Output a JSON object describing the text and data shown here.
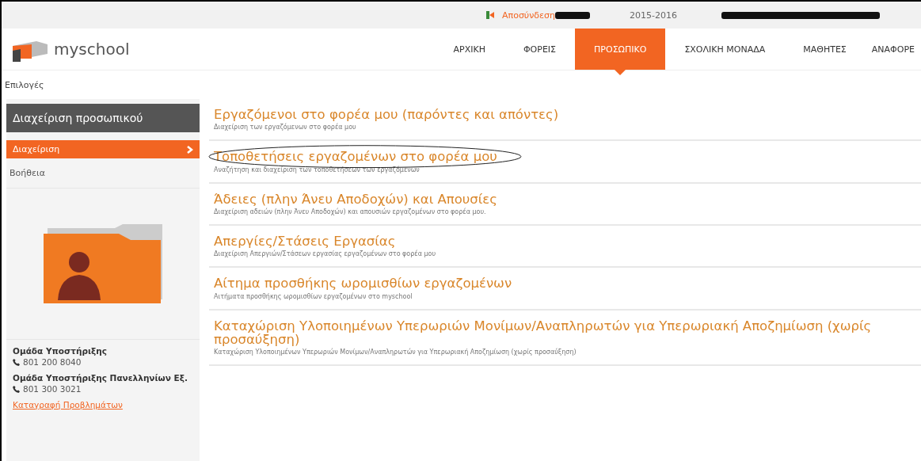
{
  "top_bar": {
    "logout": "Αποσύνδεση",
    "school_year": "2015-2016"
  },
  "logo": {
    "text": "myschool"
  },
  "nav": [
    {
      "label": "ΑΡΧΙΚΗ",
      "selected": false
    },
    {
      "label": "ΦΟΡΕΙΣ",
      "selected": false
    },
    {
      "label": "ΠΡΟΣΩΠΙΚΟ",
      "selected": true
    },
    {
      "label": "ΣΧΟΛΙΚΗ ΜΟΝΑΔΑ",
      "selected": false
    },
    {
      "label": "ΜΑΘΗΤΕΣ",
      "selected": false
    },
    {
      "label": "ΑΝΑΦΟΡΕ",
      "selected": false
    }
  ],
  "breadcrumb": "Επιλογές",
  "sidebar": {
    "title": "Διαχείριση προσωπικού",
    "items": [
      {
        "label": "Διαχείριση",
        "selected": true
      },
      {
        "label": "Βοήθεια",
        "selected": false
      }
    ],
    "contacts": [
      {
        "name": "Ομάδα Υποστήριξης",
        "phone": "801 200 8040"
      },
      {
        "name": "Ομάδα Υποστήριξης Πανελληνίων Εξ.",
        "phone": "801 300 3021"
      }
    ],
    "footer_link": "Καταγραφή Προβλημάτων"
  },
  "menu": [
    {
      "title": "Εργαζόμενοι στο φορέα μου (παρόντες και απόντες)",
      "description": "Διαχείριση των εργαζόμενων στο φορέα μου",
      "circled": false
    },
    {
      "title": "Τοποθετήσεις εργαζομένων στο φορέα μου",
      "description": "Αναζήτηση και διαχείριση των τοποθετήσεων των εργαζόμενων",
      "circled": true
    },
    {
      "title": "Άδειες (πλην Άνευ Αποδοχών) και Απουσίες",
      "description": "Διαχείριση αδειών (πλην Άνευ Αποδοχών) και απουσιών εργαζομένων στο φορέα μου.",
      "circled": false
    },
    {
      "title": "Απεργίες/Στάσεις Εργασίας",
      "description": "Διαχείριση Απεργιών/Στάσεων εργασίας εργαζομένων στο φορέα μου",
      "circled": false
    },
    {
      "title": "Αίτημα προσθήκης ωρομισθίων εργαζομένων",
      "description": "Αιτήματα προσθήκης ωρομισθίων εργαζομένων στο myschool",
      "circled": false
    },
    {
      "title": "Καταχώριση Υλοποιημένων Υπερωριών Μονίμων/Αναπληρωτών για Υπερωριακή Αποζημίωση (χωρίς προσαύξηση)",
      "description": "Καταχώριση Υλοποιημένων Υπερωριών Μονίμων/Αναπληρωτών για Υπερωριακή Αποζημίωση (χωρίς προσαύξηση)",
      "circled": false
    }
  ]
}
